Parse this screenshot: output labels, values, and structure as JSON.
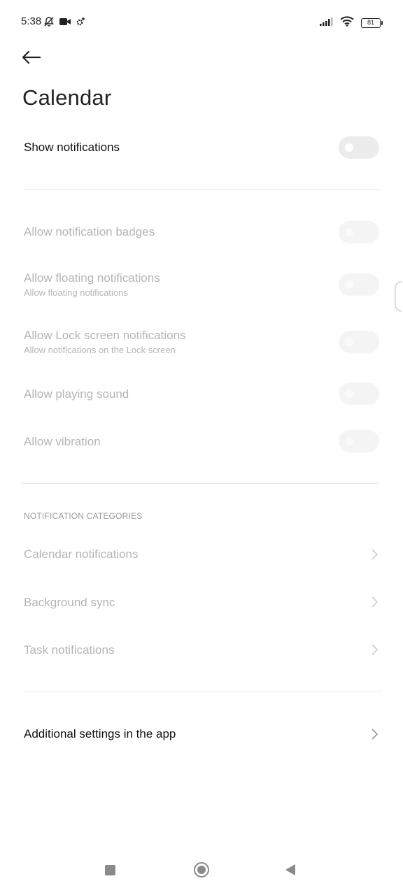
{
  "status_bar": {
    "time": "5:38",
    "battery": "81",
    "icons_left": [
      "notifications-off-icon",
      "video-icon",
      "settings-gear-icon"
    ],
    "icons_right": [
      "signal-icon",
      "wifi-icon",
      "battery-icon"
    ]
  },
  "header": {
    "title": "Calendar"
  },
  "main_toggle": {
    "label": "Show notifications",
    "state": "off"
  },
  "settings": [
    {
      "label": "Allow notification badges",
      "sub": "",
      "state": "off",
      "enabled": false
    },
    {
      "label": "Allow floating notifications",
      "sub": "Allow floating notifications",
      "state": "off",
      "enabled": false
    },
    {
      "label": "Allow Lock screen notifications",
      "sub": "Allow notifications on the Lock screen",
      "state": "off",
      "enabled": false
    },
    {
      "label": "Allow playing sound",
      "sub": "",
      "state": "off",
      "enabled": false
    },
    {
      "label": "Allow vibration",
      "sub": "",
      "state": "off",
      "enabled": false
    }
  ],
  "categories": {
    "header": "NOTIFICATION CATEGORIES",
    "items": [
      {
        "label": "Calendar notifications"
      },
      {
        "label": "Background sync"
      },
      {
        "label": "Task notifications"
      }
    ]
  },
  "additional": {
    "label": "Additional settings in the app"
  },
  "colors": {
    "background": "#ffffff",
    "text_primary": "#111111",
    "text_disabled": "#b5b5b5",
    "toggle_off": "#ececec"
  }
}
